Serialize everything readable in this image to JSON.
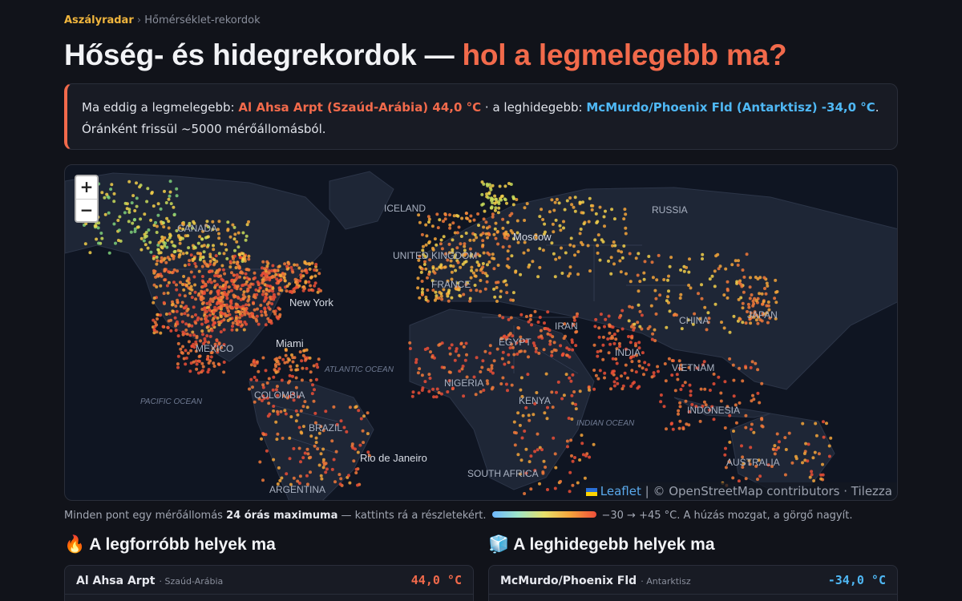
{
  "breadcrumb": {
    "site": "Aszályradar",
    "separator": "›",
    "page": "Hőmérséklet-rekordok"
  },
  "title": {
    "main": "Hőség- és hidegrekordok — ",
    "accent": "hol a legmelegebb ma?"
  },
  "summary": {
    "hot_prefix": "Ma eddig a legmelegebb: ",
    "hot_value": "Al Ahsa Arpt (Szaúd-Arábia) 44,0 °C",
    "cold_prefix": " · a leghidegebb: ",
    "cold_value": "McMurdo/Phoenix Fld (Antarktisz) -34,0 °C",
    "cold_suffix": ".",
    "update_note": "Óránként frissül ~5000 mérőállomásból."
  },
  "map": {
    "zoom_in": "+",
    "zoom_out": "−",
    "labels": {
      "canada": "CANADA",
      "iceland": "ICELAND",
      "russia": "RUSSIA",
      "moscow": "Moscow",
      "uk": "UNITED KINGDOM",
      "france": "FRANCE",
      "new_york": "New York",
      "miami": "Miami",
      "mexico": "MEXICO",
      "atlantic": "ATLANTIC OCEAN",
      "pacific": "PACIFIC OCEAN",
      "colombia": "COLOMBIA",
      "brazil": "BRAZIL",
      "rio": "Rio de Janeiro",
      "argentina": "ARGENTINA",
      "egypt": "EGYPT",
      "iran": "IRAN",
      "nigeria": "NIGERIA",
      "kenya": "KENYA",
      "south_africa": "SOUTH AFRICA",
      "india": "INDIA",
      "indian_ocean": "INDIAN OCEAN",
      "china": "CHINA",
      "japan": "JAPAN",
      "vietnam": "VIETNAM",
      "indonesia": "INDONESIA",
      "australia": "AUSTRALIA"
    },
    "attribution": {
      "leaflet": "Leaflet",
      "sep": " | ",
      "osm": "© OpenStreetMap contributors · Tilezza"
    }
  },
  "legend": {
    "prefix": "Minden pont egy mérőállomás ",
    "bold": "24 órás maximuma",
    "suffix": " — kattints rá a részletekért.",
    "range": "−30 → +45 °C. A húzás mozgat, a görgő nagyít.",
    "scale_colors": [
      "#6fb8ff",
      "#9fe5c8",
      "#e6e06a",
      "#f5a33c",
      "#ee4f3a"
    ]
  },
  "hottest": {
    "icon": "🔥",
    "title": "A legforróbb helyek ma",
    "rows": [
      {
        "name": "Al Ahsa Arpt",
        "country": "Szaúd-Arábia",
        "value": "44,0 °C"
      }
    ]
  },
  "coldest": {
    "icon": "🧊",
    "title": "A leghidegebb helyek ma",
    "rows": [
      {
        "name": "McMurdo/Phoenix Fld",
        "country": "Antarktisz",
        "value": "-34,0 °C"
      }
    ]
  },
  "colors": {
    "hot": "#f26a4b",
    "cold": "#4fb8f5",
    "brand": "#f0b53d",
    "background": "#11131a"
  }
}
